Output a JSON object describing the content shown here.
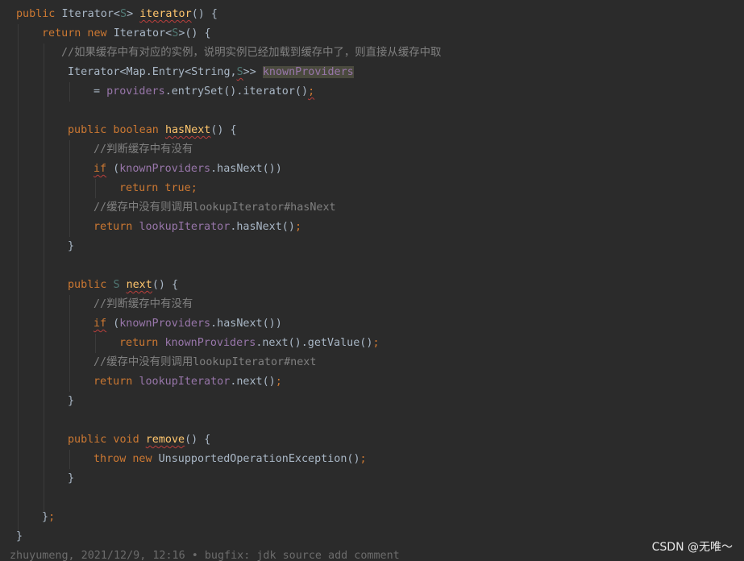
{
  "editor": {
    "lines": [
      [
        [
          "kw",
          "public "
        ],
        [
          "tp",
          "Iterator<"
        ],
        [
          "tv",
          "S"
        ],
        [
          "tp",
          "> "
        ],
        [
          "fn warn",
          "iterator"
        ],
        [
          "plain",
          "() {"
        ]
      ],
      [
        [
          "kw",
          "return new "
        ],
        [
          "tp",
          "Iterator<"
        ],
        [
          "tv",
          "S"
        ],
        [
          "tp",
          ">() {"
        ]
      ],
      [
        [
          "cmt",
          "//如果缓存中有对应的实例，说明实例已经加载到缓存中了，则直接从缓存中取"
        ]
      ],
      [
        [
          "tp",
          "Iterator<Map.Entry<String,"
        ],
        [
          "tv warn",
          "S"
        ],
        [
          "tp",
          ">> "
        ],
        [
          "hl",
          "knownProviders"
        ]
      ],
      [
        [
          "plain",
          "= "
        ],
        [
          "fld",
          "providers"
        ],
        [
          "plain",
          ".entrySet().iterator()"
        ],
        [
          "semi warn",
          ";"
        ]
      ],
      [],
      [
        [
          "kw",
          "public boolean "
        ],
        [
          "fn warn",
          "hasNext"
        ],
        [
          "plain",
          "() {"
        ]
      ],
      [
        [
          "cmt",
          "//判断缓存中有没有"
        ]
      ],
      [
        [
          "kw warn",
          "if"
        ],
        [
          "plain",
          " ("
        ],
        [
          "fld",
          "knownProviders"
        ],
        [
          "plain",
          ".hasNext())"
        ]
      ],
      [
        [
          "kw",
          "return true"
        ],
        [
          "semi",
          ";"
        ]
      ],
      [
        [
          "cmt",
          "//缓存中没有则调用lookupIterator#hasNext"
        ]
      ],
      [
        [
          "kw",
          "return "
        ],
        [
          "fld",
          "lookupIterator"
        ],
        [
          "plain",
          ".hasNext()"
        ],
        [
          "semi",
          ";"
        ]
      ],
      [
        [
          "plain",
          "}"
        ]
      ],
      [],
      [
        [
          "kw",
          "public "
        ],
        [
          "tv",
          "S "
        ],
        [
          "fn warn",
          "next"
        ],
        [
          "plain",
          "() {"
        ]
      ],
      [
        [
          "cmt",
          "//判断缓存中有没有"
        ]
      ],
      [
        [
          "kw warn",
          "if"
        ],
        [
          "plain",
          " ("
        ],
        [
          "fld",
          "knownProviders"
        ],
        [
          "plain",
          ".hasNext())"
        ]
      ],
      [
        [
          "kw",
          "return "
        ],
        [
          "fld",
          "knownProviders"
        ],
        [
          "plain",
          ".next().getValue()"
        ],
        [
          "semi",
          ";"
        ]
      ],
      [
        [
          "cmt",
          "//缓存中没有则调用lookupIterator#next"
        ]
      ],
      [
        [
          "kw",
          "return "
        ],
        [
          "fld",
          "lookupIterator"
        ],
        [
          "plain",
          ".next()"
        ],
        [
          "semi",
          ";"
        ]
      ],
      [
        [
          "plain",
          "}"
        ]
      ],
      [],
      [
        [
          "kw",
          "public void "
        ],
        [
          "fn warn",
          "remove"
        ],
        [
          "plain",
          "() {"
        ]
      ],
      [
        [
          "kw",
          "throw new "
        ],
        [
          "plain",
          "UnsupportedOperationException()"
        ],
        [
          "semi",
          ";"
        ]
      ],
      [
        [
          "plain",
          "}"
        ]
      ],
      [],
      [
        [
          "plain",
          "}"
        ],
        [
          "semi",
          ";"
        ]
      ],
      [
        [
          "plain",
          "}"
        ]
      ]
    ],
    "annotation": "zhuyumeng, 2021/12/9, 12:16 • bugfix: jdk source add comment"
  },
  "watermark": "CSDN @无唯～"
}
